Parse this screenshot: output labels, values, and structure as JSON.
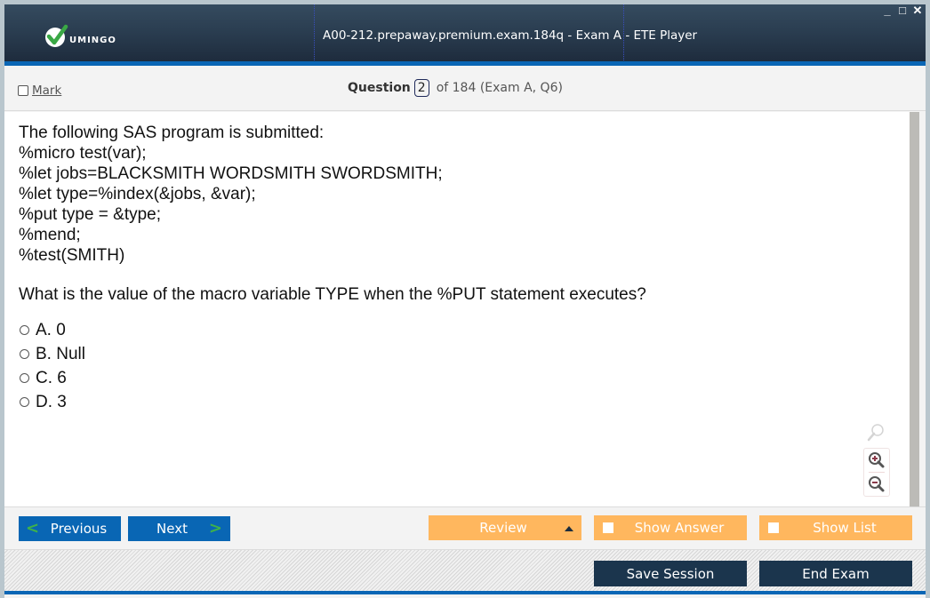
{
  "window": {
    "title": "A00-212.prepaway.premium.exam.184q - Exam A - ETE Player",
    "logo_text": "UMINGO",
    "controls": {
      "minimize": "_",
      "maximize": "□",
      "close": "✕"
    }
  },
  "header": {
    "mark_label": "Mark",
    "mark_checked": false,
    "question_label": "Question",
    "question_number": "2",
    "question_suffix": "of 184 (Exam A, Q6)"
  },
  "question": {
    "lines": [
      "The following SAS program is submitted:",
      "%micro test(var);",
      "%let jobs=BLACKSMITH WORDSMITH SWORDSMITH;",
      "%let type=%index(&jobs, &var);",
      "%put type = &type;",
      "%mend;",
      "%test(SMITH)"
    ],
    "prompt": "What is the value of the macro variable TYPE when the %PUT statement executes?",
    "options": [
      {
        "label": "A. 0",
        "selected": false
      },
      {
        "label": "B. Null",
        "selected": false
      },
      {
        "label": "C. 6",
        "selected": false
      },
      {
        "label": "D. 3",
        "selected": false
      }
    ]
  },
  "zoom_tools": {
    "icons": [
      "magnifier-icon",
      "zoom-in-icon",
      "zoom-out-icon"
    ]
  },
  "nav": {
    "previous_label": "Previous",
    "next_label": "Next",
    "review_label": "Review",
    "show_answer_label": "Show Answer",
    "show_answer_checked": false,
    "show_list_label": "Show List",
    "show_list_checked": false
  },
  "footer": {
    "save_session_label": "Save Session",
    "end_exam_label": "End Exam"
  },
  "colors": {
    "titlebar": "#2a3d50",
    "accent_blue": "#0966b4",
    "orange": "#ffb75e",
    "dark_button": "#1b354d",
    "chevron_green": "#3fb24a"
  }
}
